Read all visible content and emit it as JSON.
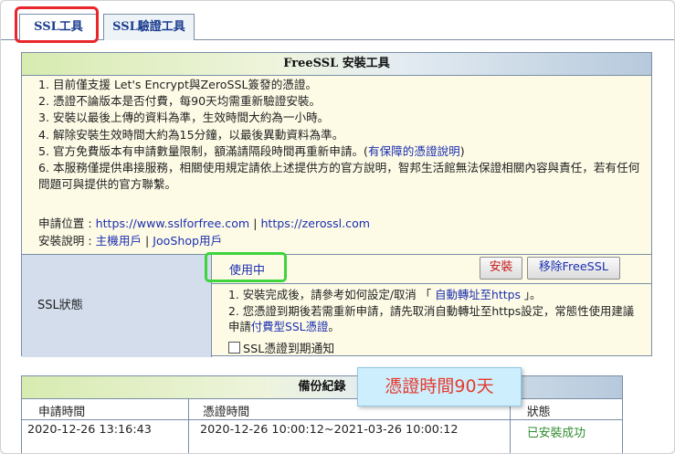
{
  "tabs": [
    {
      "label": "SSL工具"
    },
    {
      "label": "SSL驗證工具"
    }
  ],
  "panel": {
    "title": "FreeSSL 安裝工具",
    "notes": [
      "1. 目前僅支援 Let's Encrypt與ZeroSSL簽發的憑證。",
      "2. 憑證不論版本是否付費，每90天均需重新驗證安裝。",
      "3. 安裝以最後上傳的資料為準，生效時間大約為一小時。",
      "4. 解除安裝生效時間大約為15分鐘，以最後異動資料為準。",
      "5. 官方免費版本有申請數量限制，額滿請隔段時間再重新申請。(",
      "有保障的憑證說明",
      ")",
      "6. 本服務僅提供串接服務，相關使用規定請依上述提供方的官方說明，智邦生活館無法保證相關內容與責任，若有任何問題可與提供的官方聯繫。"
    ],
    "apply_label": "申請位置 : ",
    "apply_link1": "https://www.sslforfree.com",
    "apply_sep": " | ",
    "apply_link2": "https://zerossl.com",
    "install_label": "安裝說明 : ",
    "install_link1": "主機用戶",
    "install_link2": "JooShop用戶"
  },
  "status": {
    "label": "SSL狀態",
    "value": "使用中",
    "install_button": "安裝",
    "remove_button": "移除FreeSSL",
    "note1_a": "1. 安裝完成後，請參考如何設定/取消 「",
    "note1_link": " 自動轉址至https ",
    "note1_b": "」。",
    "note2_a": "2. 您憑證到期後若需重新申請，請先取消自動轉址至https設定，常態性使用建議申請",
    "note2_link": "付費型SSL憑證",
    "note2_b": "。",
    "notify_label": "SSL憑證到期通知"
  },
  "backup": {
    "title": "備份紀錄",
    "columns": [
      "申請時間",
      "憑證時間",
      "狀態"
    ],
    "rows": [
      {
        "apply_time": "2020-12-26 13:16:43",
        "cert_time": "2020-12-26 10:00:12~2021-03-26 10:00:12",
        "state": "已安裝成功"
      }
    ]
  },
  "callout": "憑證時間90天"
}
